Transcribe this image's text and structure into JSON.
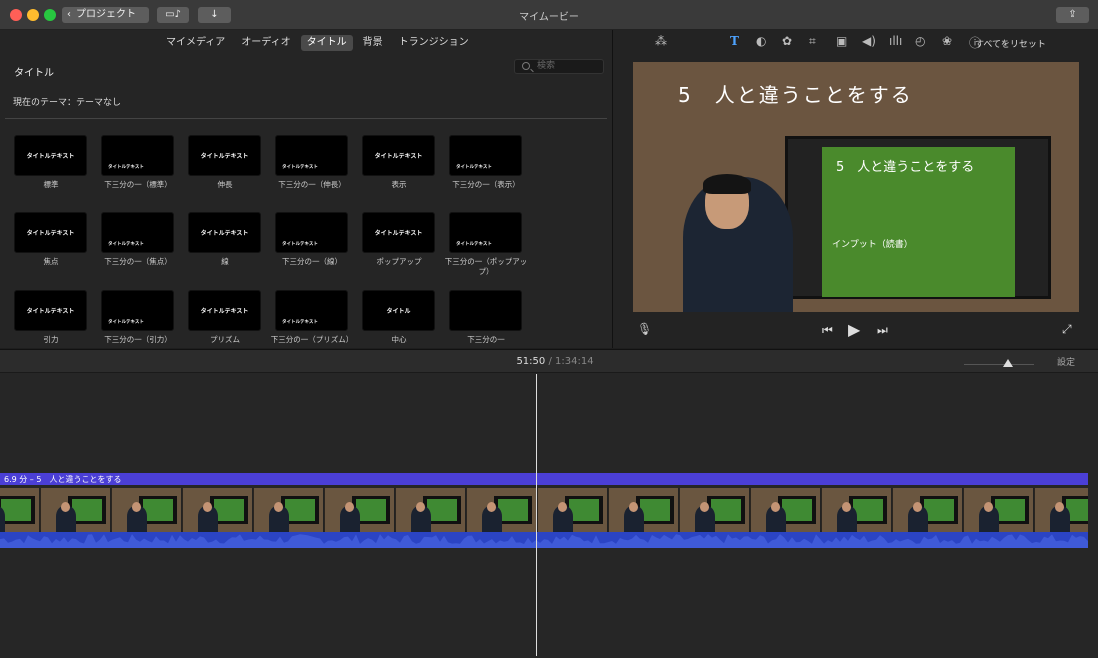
{
  "window": {
    "title": "マイムービー",
    "back_label": "プロジェクト"
  },
  "browser": {
    "tabs": [
      {
        "label": "マイメディア",
        "active": false
      },
      {
        "label": "オーディオ",
        "active": false
      },
      {
        "label": "タイトル",
        "active": true
      },
      {
        "label": "背景",
        "active": false
      },
      {
        "label": "トランジション",
        "active": false
      }
    ],
    "section_title": "タイトル",
    "search_placeholder": "検索",
    "theme_label": "現在のテーマ：テーマなし",
    "titles": [
      {
        "label": "標準",
        "text": "タイトルテキスト"
      },
      {
        "label": "下三分の一（標準）",
        "text": "タイトルテキスト"
      },
      {
        "label": "伸長",
        "text": "タイトルテキスト"
      },
      {
        "label": "下三分の一（伸長）",
        "text": "タイトルテキスト"
      },
      {
        "label": "表示",
        "text": "タイトルテキスト"
      },
      {
        "label": "下三分の一（表示）",
        "text": "タイトルテキスト"
      },
      {
        "label": "焦点",
        "text": "タイトルテキスト"
      },
      {
        "label": "下三分の一（焦点）",
        "text": "タイトルテキスト"
      },
      {
        "label": "線",
        "text": "タイトルテキスト"
      },
      {
        "label": "下三分の一（線）",
        "text": "タイトルテキスト"
      },
      {
        "label": "ポップアップ",
        "text": "タイトルテキスト"
      },
      {
        "label": "下三分の一（ポップアップ）",
        "text": "タイトルテキスト"
      },
      {
        "label": "引力",
        "text": "タイトルテキスト"
      },
      {
        "label": "下三分の一（引力）",
        "text": "タイトルテキスト"
      },
      {
        "label": "プリズム",
        "text": "タイトルテキスト"
      },
      {
        "label": "下三分の一（プリズム）",
        "text": "タイトルテキスト"
      },
      {
        "label": "中心",
        "text": "タイトル"
      },
      {
        "label": "下三分の一",
        "text": ""
      }
    ]
  },
  "viewer": {
    "reset_label": "すべてをリセット",
    "caption": "5　人と違うことをする",
    "screen_caption": "5　人と違うことをする",
    "screen_subcaption": "インプット（読書）"
  },
  "timeline": {
    "current_time": "51:50",
    "total_time": "/ 1:34:14",
    "settings_label": "設定",
    "title_clip": "6.9 分 – 5　人と違うことをする"
  },
  "colors": {
    "accent": "#4b3fd6",
    "audio": "#2b44c4",
    "active_tab": "#4a4a4a"
  }
}
